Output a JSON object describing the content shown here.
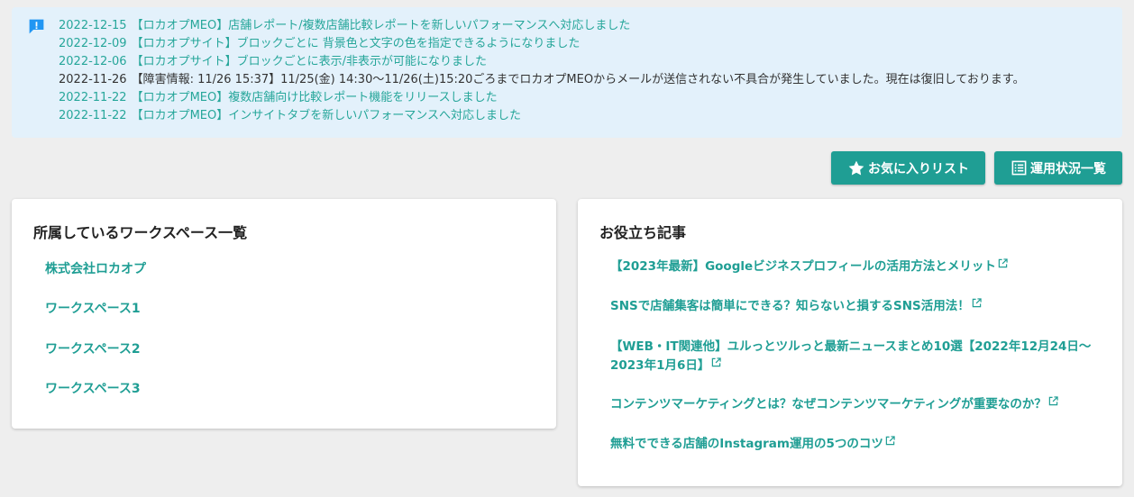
{
  "notices": [
    {
      "date": "2022-12-15",
      "text": "【ロカオプMEO】店舗レポート/複数店舗比較レポートを新しいパフォーマンスへ対応しました"
    },
    {
      "date": "2022-12-09",
      "text": "【ロカオプサイト】ブロックごとに 背景色と文字の色を指定できるようになりました"
    },
    {
      "date": "2022-12-06",
      "text": "【ロカオプサイト】ブロックごとに表示/非表示が可能になりました"
    },
    {
      "date": "2022-11-26",
      "text": "【障害情報: 11/26 15:37】11/25(金) 14:30〜11/26(土)15:20ごろまでロカオプMEOからメールが送信されない不具合が発生していました。現在は復旧しております。"
    },
    {
      "date": "2022-11-22",
      "text": "【ロカオプMEO】複数店舗向け比較レポート機能をリリースしました"
    },
    {
      "date": "2022-11-22",
      "text": "【ロカオプMEO】インサイトタブを新しいパフォーマンスへ対応しました"
    }
  ],
  "buttons": {
    "favorites": "お気に入りリスト",
    "status": "運用状況一覧"
  },
  "workspaces": {
    "title": "所属しているワークスペース一覧",
    "items": [
      "株式会社ロカオプ",
      "ワークスペース1",
      "ワークスペース2",
      "ワークスペース3"
    ]
  },
  "articles": {
    "title": "お役立ち記事",
    "items": [
      "【2023年最新】Googleビジネスプロフィールの活用方法とメリット",
      "SNSで店舗集客は簡単にできる？知らないと損するSNS活用法！",
      "【WEB・IT関連他】ユルっとツルっと最新ニュースまとめ10選【2022年12月24日〜2023年1月6日】",
      "コンテンツマーケティングとは？なぜコンテンツマーケティングが重要なのか？",
      "無料でできる店舗のInstagram運用の5つのコツ"
    ]
  },
  "colors": {
    "accent": "#1f9e94",
    "notice_bg": "#e3f1fb",
    "icon_blue": "#2196f3"
  }
}
